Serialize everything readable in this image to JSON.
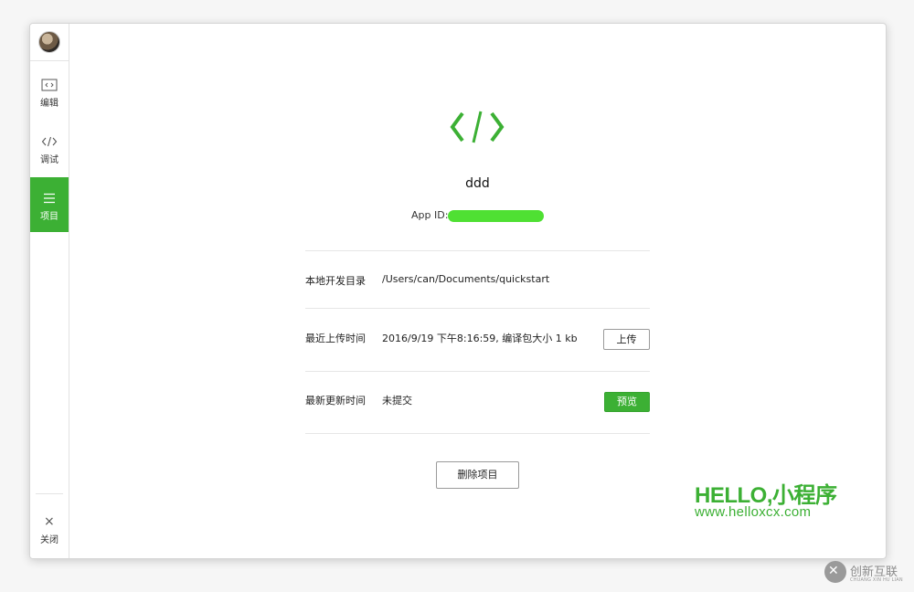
{
  "sidebar": {
    "items": [
      {
        "label": "编辑",
        "icon": "editor-icon"
      },
      {
        "label": "调试",
        "icon": "debug-code-icon"
      },
      {
        "label": "项目",
        "icon": "project-menu-icon",
        "active": true
      }
    ],
    "close_label": "关闭",
    "close_icon": "×"
  },
  "project": {
    "name": "ddd",
    "app_id_label": "App ID:"
  },
  "rows": [
    {
      "label": "本地开发目录",
      "value": "/Users/can/Documents/quickstart"
    },
    {
      "label": "最近上传时间",
      "value": "2016/9/19 下午8:16:59, 编译包大小 1 kb",
      "button": "上传"
    },
    {
      "label": "最新更新时间",
      "value": "未提交",
      "button": "预览"
    }
  ],
  "delete_button": "删除项目",
  "branding": {
    "title": "HELLO,小程序",
    "url": "www.helloxcx.com"
  },
  "watermark": {
    "text": "创新互联",
    "sub": "CHUANG XIN HU LIAN"
  },
  "colors": {
    "accent": "#3cb034",
    "appid_mask": "#4fe033"
  }
}
